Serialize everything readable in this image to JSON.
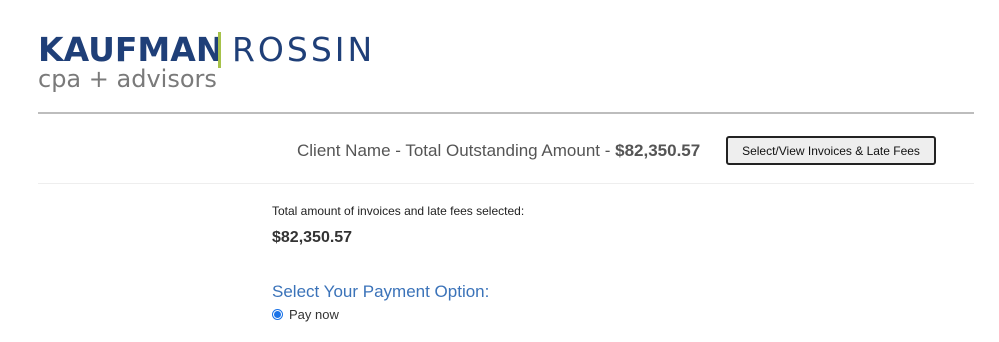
{
  "logo": {
    "brand_primary": "KAUFMAN",
    "brand_secondary": "ROSSIN",
    "tagline": "cpa + advisors",
    "brand_color": "#1f3f78",
    "divider_color": "#a6c24a",
    "tagline_color": "#7a7a7a"
  },
  "summary": {
    "label": "Client Name - Total Outstanding Amount - ",
    "amount": "$82,350.57",
    "select_button_label": "Select/View Invoices & Late Fees"
  },
  "totals": {
    "label": "Total amount of invoices and late fees selected:",
    "value": "$82,350.57"
  },
  "payment": {
    "title": "Select Your Payment Option:",
    "title_color": "#3b73b9",
    "options": [
      {
        "label": "Pay now",
        "selected": true
      }
    ]
  }
}
